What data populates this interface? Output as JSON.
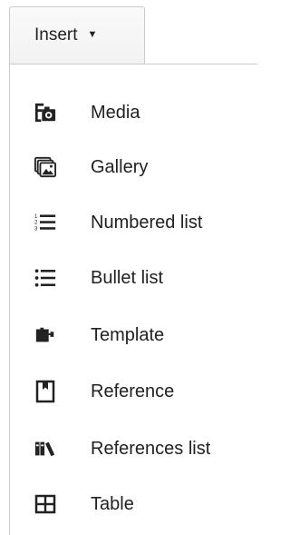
{
  "toolbar": {
    "insert_label": "Insert",
    "caret_icon": "caret-down-icon"
  },
  "menu": {
    "items": [
      {
        "label": "Media",
        "icon": "media-icon"
      },
      {
        "label": "Gallery",
        "icon": "gallery-icon"
      },
      {
        "label": "Numbered list",
        "icon": "numbered-list-icon"
      },
      {
        "label": "Bullet list",
        "icon": "bullet-list-icon"
      },
      {
        "label": "Template",
        "icon": "template-icon"
      },
      {
        "label": "Reference",
        "icon": "reference-icon"
      },
      {
        "label": "References list",
        "icon": "references-list-icon"
      },
      {
        "label": "Table",
        "icon": "table-icon"
      }
    ]
  },
  "colors": {
    "icon": "#222222",
    "text": "#202122",
    "border": "#c8ccd1"
  }
}
